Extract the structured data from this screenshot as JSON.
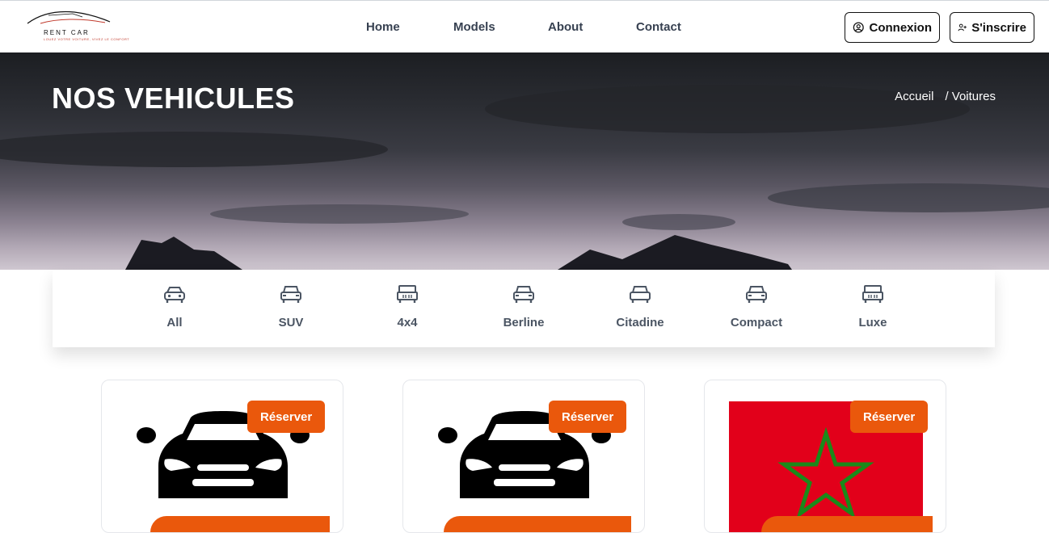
{
  "logo": {
    "text": "RENT CAR",
    "sub": "LOUEZ VOTRE VOITURE, VIVEZ LE CONFORT"
  },
  "nav": [
    {
      "label": "Home"
    },
    {
      "label": "Models"
    },
    {
      "label": "About"
    },
    {
      "label": "Contact"
    }
  ],
  "auth": {
    "login": "Connexion",
    "signup": "S'inscrire"
  },
  "hero": {
    "title": "NOS VEHICULES",
    "crumb_home": "Accueil",
    "crumb_current": "/ Voitures"
  },
  "categories": [
    {
      "label": "All",
      "icon": "car-front-icon"
    },
    {
      "label": "SUV",
      "icon": "car-icon"
    },
    {
      "label": "4x4",
      "icon": "jeep-icon"
    },
    {
      "label": "Berline",
      "icon": "car-icon"
    },
    {
      "label": "Citadine",
      "icon": "car-icon"
    },
    {
      "label": "Compact",
      "icon": "car-icon"
    },
    {
      "label": "Luxe",
      "icon": "jeep-icon"
    }
  ],
  "cards": [
    {
      "button": "Réserver",
      "image": "car-silhouette"
    },
    {
      "button": "Réserver",
      "image": "car-silhouette"
    },
    {
      "button": "Réserver",
      "image": "morocco-flag"
    }
  ],
  "colors": {
    "accent": "#ea580c",
    "flag_red": "#e2001a",
    "flag_green": "#1a8a1a"
  }
}
